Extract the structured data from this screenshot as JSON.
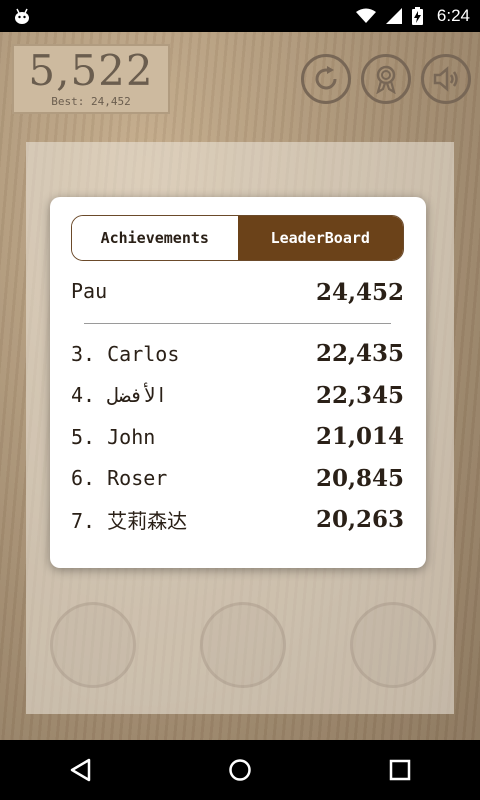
{
  "status_bar": {
    "time": "6:24"
  },
  "game": {
    "score": "5,522",
    "best": "Best: 24,452",
    "buttons": [
      {
        "icon": "restart-icon"
      },
      {
        "icon": "achievement-ribbon-icon"
      },
      {
        "icon": "sound-icon"
      }
    ]
  },
  "dialog": {
    "tabs": [
      {
        "label": "Achievements",
        "active": false
      },
      {
        "label": "LeaderBoard",
        "active": true
      }
    ],
    "player": {
      "name": "Pau",
      "score": "24,452"
    },
    "entries": [
      {
        "rank_name": "3. Carlos",
        "score": "22,435"
      },
      {
        "rank_name": "4. الأفضل",
        "score": "22,345"
      },
      {
        "rank_name": "5. John",
        "score": "21,014"
      },
      {
        "rank_name": "6. Roser",
        "score": "20,845"
      },
      {
        "rank_name": "7. 艾莉森达",
        "score": "20,263"
      }
    ]
  },
  "colors": {
    "accent": "#6b4219",
    "panel_wood": "#8e7351"
  }
}
